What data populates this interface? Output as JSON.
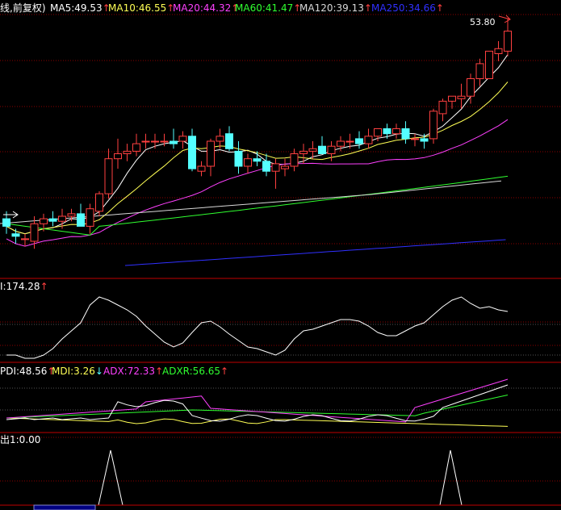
{
  "main_panel": {
    "legend": [
      {
        "key": "title",
        "text": "线,前复权)",
        "color": "#ffffff"
      },
      {
        "key": "ma5",
        "text": "MA5:49.53",
        "color": "#ffffff",
        "arrow": "↑"
      },
      {
        "key": "ma10",
        "text": "MA10:46.55",
        "color": "#ffff55",
        "arrow": "↑"
      },
      {
        "key": "ma20",
        "text": "MA20:44.32",
        "color": "#ff40ff",
        "arrow": "↑"
      },
      {
        "key": "ma60",
        "text": "MA60:41.47",
        "color": "#30ff30",
        "arrow": "↑"
      },
      {
        "key": "ma120",
        "text": "MA120:39.13",
        "color": "#d8d8d8",
        "arrow": "↑"
      },
      {
        "key": "ma250",
        "text": "MA250:34.66",
        "color": "#3030ff",
        "arrow": "↑"
      }
    ],
    "high_label": "53.80",
    "arrow_color": "#ff4040"
  },
  "cci_panel": {
    "legend": [
      {
        "key": "cci",
        "text": "I:174.28",
        "color": "#ffffff",
        "arrow": "↑"
      }
    ]
  },
  "dmi_panel": {
    "legend": [
      {
        "key": "pdi",
        "text": "PDI:48.56",
        "color": "#ffffff",
        "arrow": "↑"
      },
      {
        "key": "mdi",
        "text": "MDI:3.26",
        "color": "#ffff55",
        "arrow": "↓"
      },
      {
        "key": "adx",
        "text": "ADX:72.33",
        "color": "#ff40ff",
        "arrow": "↑"
      },
      {
        "key": "adxr",
        "text": "ADXR:56.65",
        "color": "#30ff30",
        "arrow": "↑"
      }
    ]
  },
  "signal_panel": {
    "legend": [
      {
        "key": "signal",
        "text": "出1:0.00",
        "color": "#ffffff"
      }
    ]
  },
  "colors": {
    "background": "#000000",
    "grid_red": "#8b0000",
    "panel_border": "#c00000",
    "up_candle": "#ff4040",
    "down_candle": "#54ffff",
    "date_bar": "#000080"
  },
  "chart_data": {
    "type": "candlestick",
    "candles": [
      [
        48.2,
        48.5,
        47.6,
        47.9
      ],
      [
        47.6,
        47.8,
        47.2,
        47.5
      ],
      [
        47.4,
        47.6,
        47.1,
        47.4
      ],
      [
        47.3,
        48.3,
        47.0,
        48.0
      ],
      [
        48.0,
        48.4,
        47.7,
        48.2
      ],
      [
        48.2,
        48.5,
        47.9,
        48.1
      ],
      [
        48.1,
        48.6,
        47.8,
        48.3
      ],
      [
        48.3,
        48.6,
        48.1,
        48.4
      ],
      [
        48.4,
        48.8,
        47.9,
        47.9
      ],
      [
        47.9,
        48.8,
        47.6,
        48.6
      ],
      [
        48.5,
        49.3,
        48.3,
        49.2
      ],
      [
        49.2,
        51.0,
        49.0,
        50.6
      ],
      [
        50.6,
        51.4,
        50.2,
        50.8
      ],
      [
        50.8,
        51.2,
        50.5,
        50.9
      ],
      [
        50.9,
        51.6,
        50.7,
        51.2
      ],
      [
        51.3,
        51.6,
        51.0,
        51.3
      ],
      [
        51.3,
        51.6,
        51.0,
        51.3
      ],
      [
        51.3,
        51.6,
        51.1,
        51.3
      ],
      [
        51.3,
        51.8,
        51.0,
        51.2
      ],
      [
        51.3,
        51.7,
        51.0,
        51.5
      ],
      [
        51.5,
        51.8,
        50.1,
        50.2
      ],
      [
        50.1,
        50.5,
        49.9,
        50.3
      ],
      [
        50.3,
        51.4,
        49.9,
        51.3
      ],
      [
        51.3,
        51.8,
        51.0,
        51.5
      ],
      [
        51.6,
        51.9,
        50.9,
        51.0
      ],
      [
        50.9,
        51.3,
        50.0,
        50.3
      ],
      [
        50.3,
        50.8,
        50.0,
        50.6
      ],
      [
        50.6,
        50.9,
        50.3,
        50.5
      ],
      [
        50.5,
        50.8,
        49.9,
        50.1
      ],
      [
        50.1,
        50.6,
        49.4,
        50.4
      ],
      [
        50.2,
        50.6,
        49.9,
        50.3
      ],
      [
        50.3,
        51.0,
        50.1,
        50.8
      ],
      [
        50.8,
        51.2,
        50.4,
        50.9
      ],
      [
        50.9,
        51.3,
        50.6,
        51.0
      ],
      [
        51.1,
        51.5,
        50.8,
        50.8
      ],
      [
        50.8,
        51.3,
        50.5,
        51.1
      ],
      [
        51.1,
        51.5,
        50.9,
        51.3
      ],
      [
        51.3,
        51.6,
        51.0,
        51.3
      ],
      [
        51.4,
        51.7,
        51.0,
        51.2
      ],
      [
        51.2,
        51.8,
        51.0,
        51.5
      ],
      [
        51.5,
        51.8,
        51.3,
        51.8
      ],
      [
        51.8,
        52.0,
        51.4,
        51.6
      ],
      [
        51.6,
        52.0,
        51.4,
        51.8
      ],
      [
        51.8,
        52.1,
        51.2,
        51.4
      ],
      [
        51.4,
        51.6,
        51.1,
        51.4
      ],
      [
        51.4,
        51.6,
        51.0,
        51.3
      ],
      [
        51.4,
        52.6,
        51.2,
        52.5
      ],
      [
        52.4,
        53.0,
        52.1,
        52.9
      ],
      [
        52.9,
        53.1,
        52.6,
        53.1
      ],
      [
        53.0,
        53.6,
        52.6,
        53.1
      ],
      [
        53.1,
        54.0,
        52.8,
        53.8
      ],
      [
        53.8,
        54.6,
        53.5,
        54.4
      ],
      [
        53.8,
        54.9,
        53.8,
        54.9
      ],
      [
        54.8,
        55.3,
        54.5,
        55.0
      ],
      [
        54.9,
        56.2,
        54.7,
        55.7
      ]
    ]
  }
}
